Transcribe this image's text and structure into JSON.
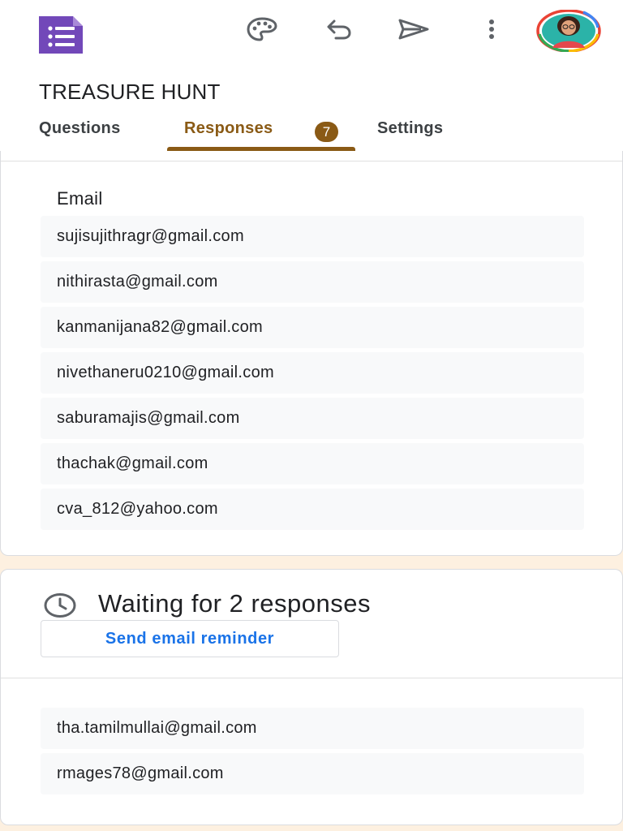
{
  "header": {
    "app_icon": "google-forms-list-icon",
    "actions": [
      {
        "name": "customize-theme-button",
        "icon": "palette-icon"
      },
      {
        "name": "undo-button",
        "icon": "undo-icon"
      },
      {
        "name": "send-button",
        "icon": "send-icon"
      },
      {
        "name": "more-options-button",
        "icon": "more-vert-icon"
      }
    ],
    "avatar_icon": "profile-avatar"
  },
  "form": {
    "title": "TREASURE HUNT"
  },
  "tabs": [
    {
      "label": "Questions",
      "active": false
    },
    {
      "label": "Responses",
      "active": true,
      "badge": "7"
    },
    {
      "label": "Settings",
      "active": false
    }
  ],
  "responses": {
    "column_header": "Email",
    "emails": [
      "sujisujithragr@gmail.com",
      "nithirasta@gmail.com",
      "kanmanijana82@gmail.com",
      "nivethaneru0210@gmail.com",
      "saburamajis@gmail.com",
      "thachak@gmail.com",
      "cva_812@yahoo.com"
    ]
  },
  "waiting": {
    "icon": "clock-icon",
    "text": "Waiting for 2 responses",
    "reminder_label": "Send email reminder",
    "emails": [
      "tha.tamilmullai@gmail.com",
      "rmages78@gmail.com"
    ]
  },
  "colors": {
    "accent": "#8a5a15",
    "forms_purple": "#7248b9",
    "link_blue": "#1a73e8",
    "background": "#fdf0e0"
  }
}
